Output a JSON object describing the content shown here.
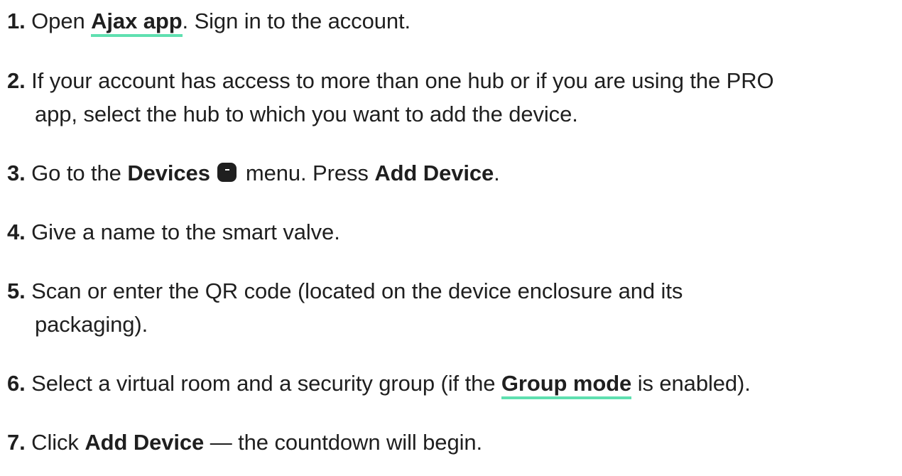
{
  "colors": {
    "text": "#1f1f1f",
    "link_underline": "#5fe0b0"
  },
  "steps": [
    {
      "num": "1.",
      "pre": "Open",
      "link": "Ajax app",
      "post": ". Sign in to the account."
    },
    {
      "num": "2.",
      "line1": "If your account has access to more than one hub or if you are using the PRO",
      "line2": "app, select the hub to which you want to add the device."
    },
    {
      "num": "3.",
      "pre": "Go to the",
      "bold1": "Devices",
      "icon": "devices-icon",
      "mid": "menu. Press",
      "bold2": "Add Device",
      "post": "."
    },
    {
      "num": "4.",
      "text": "Give a name to the smart valve."
    },
    {
      "num": "5.",
      "line1": "Scan or enter the QR code (located on the device enclosure and its",
      "line2": "packaging)."
    },
    {
      "num": "6.",
      "pre": "Select a virtual room and a security group (if the",
      "link": "Group mode",
      "post": "is enabled)."
    },
    {
      "num": "7.",
      "pre": "Click",
      "bold": "Add Device",
      "post": "— the countdown will begin."
    }
  ]
}
